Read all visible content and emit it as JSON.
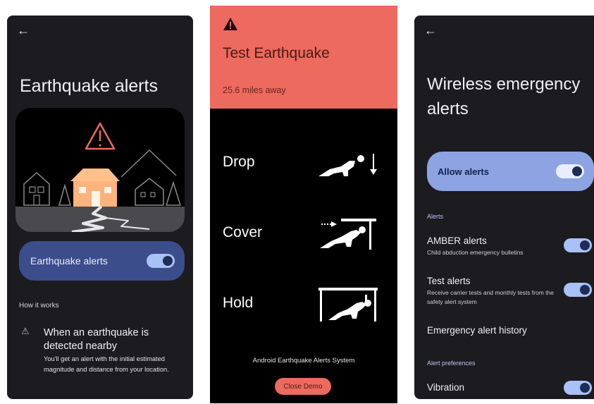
{
  "colors": {
    "panel_bg": "#1c1b1f",
    "alert_red": "#ec6a5e",
    "card_blue_dark": "#3b4d8a",
    "card_blue_light": "#8ea3e2",
    "toggle_on": "#a8c1f7"
  },
  "screen1": {
    "back_icon": "back-arrow-icon",
    "title": "Earthquake alerts",
    "toggle_card": {
      "label": "Earthquake alerts",
      "enabled": true
    },
    "section_label": "How it works",
    "info": {
      "icon": "warning-triangle-icon",
      "heading": "When an earthquake is detected nearby",
      "body": "You'll get an alert with the initial estimated magnitude and distance from your location."
    }
  },
  "screen2": {
    "icon": "warning-filled-icon",
    "title": "Test Earthquake",
    "distance": "25.6 miles away",
    "steps": [
      {
        "label": "Drop",
        "icon": "drop-pose-icon"
      },
      {
        "label": "Cover",
        "icon": "cover-pose-icon"
      },
      {
        "label": "Hold",
        "icon": "hold-pose-icon"
      }
    ],
    "system_name": "Android Earthquake Alerts System",
    "close_button": "Close Demo"
  },
  "screen3": {
    "back_icon": "back-arrow-icon",
    "title": "Wireless emergency alerts",
    "allow_card": {
      "label": "Allow alerts",
      "enabled": true
    },
    "section_alerts": "Alerts",
    "amber": {
      "label": "AMBER alerts",
      "sub": "Child abduction emergency bulletins",
      "enabled": true
    },
    "test": {
      "label": "Test alerts",
      "sub": "Receive carrier tests and monthly tests from the safety alert system",
      "enabled": true
    },
    "history": "Emergency alert history",
    "section_prefs": "Alert preferences",
    "vibration": {
      "label": "Vibration",
      "enabled": true
    }
  }
}
